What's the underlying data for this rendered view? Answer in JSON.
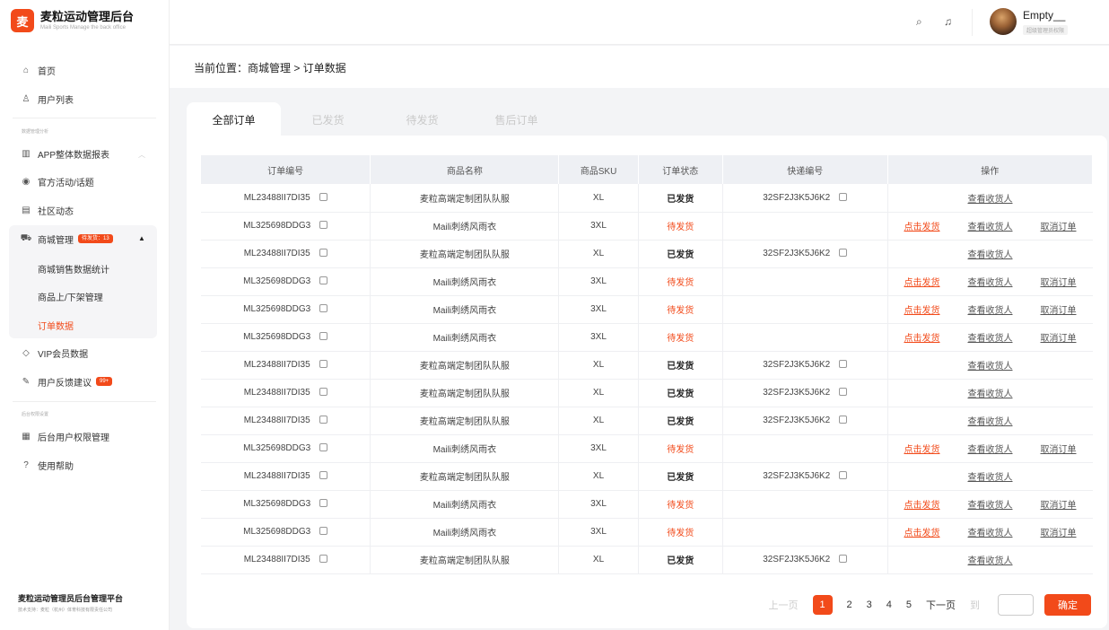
{
  "brand": {
    "title": "麦粒运动管理后台",
    "subtitle": "Maili Sports Manage the back office",
    "logo_text": "麦"
  },
  "sidebar": {
    "items_top": [
      {
        "label": "首页",
        "icon": "home-icon"
      },
      {
        "label": "用户列表",
        "icon": "user-icon"
      }
    ],
    "group1": "数据管理分析",
    "group1_items": [
      {
        "label": "APP整体数据报表",
        "icon": "bar-chart-icon"
      },
      {
        "label": "官方活动/话题",
        "icon": "activity-icon"
      },
      {
        "label": "社区动态",
        "icon": "community-icon"
      }
    ],
    "mall": {
      "label": "商城管理",
      "badge": "待发货：13",
      "icon": "cart-icon"
    },
    "mall_sub": [
      "商城销售数据统计",
      "商品上/下架管理",
      "订单数据"
    ],
    "items_after": [
      {
        "label": "VIP会员数据",
        "icon": "diamond-icon"
      },
      {
        "label": "用户反馈建议",
        "icon": "feedback-icon",
        "badge": "99+"
      }
    ],
    "group2": "后台权限设置",
    "group2_items": [
      {
        "label": "后台用户权限管理",
        "icon": "grid-icon"
      },
      {
        "label": "使用帮助",
        "icon": "help-icon"
      }
    ],
    "footer_title": "麦粒运动管理员后台管理平台",
    "footer_sub": "技术支持：麦粒（杭州）体育科技有限责任公司"
  },
  "header": {
    "user_name": "Empty__",
    "user_role": "超级管理员权限"
  },
  "breadcrumb": "当前位置：商城管理 > 订单数据",
  "tabs": [
    "全部订单",
    "已发货",
    "待发货",
    "售后订单"
  ],
  "table": {
    "headers": [
      "订单编号",
      "商品名称",
      "商品SKU",
      "订单状态",
      "快递编号",
      "操作"
    ],
    "actions": {
      "ship": "点击发货",
      "view": "查看收货人",
      "cancel": "取消订单"
    },
    "rows": [
      {
        "id": "ML23488II7DI35",
        "name": "麦粒高端定制团队队服",
        "sku": "XL",
        "status": "已发货",
        "tracking": "32SF2J3K5J6K2",
        "done": true
      },
      {
        "id": "ML325698DDG3",
        "name": "Maili刺绣风雨衣",
        "sku": "3XL",
        "status": "待发货",
        "tracking": "",
        "done": false
      },
      {
        "id": "ML23488II7DI35",
        "name": "麦粒高端定制团队队服",
        "sku": "XL",
        "status": "已发货",
        "tracking": "32SF2J3K5J6K2",
        "done": true
      },
      {
        "id": "ML325698DDG3",
        "name": "Maili刺绣风雨衣",
        "sku": "3XL",
        "status": "待发货",
        "tracking": "",
        "done": false
      },
      {
        "id": "ML325698DDG3",
        "name": "Maili刺绣风雨衣",
        "sku": "3XL",
        "status": "待发货",
        "tracking": "",
        "done": false
      },
      {
        "id": "ML325698DDG3",
        "name": "Maili刺绣风雨衣",
        "sku": "3XL",
        "status": "待发货",
        "tracking": "",
        "done": false
      },
      {
        "id": "ML23488II7DI35",
        "name": "麦粒高端定制团队队服",
        "sku": "XL",
        "status": "已发货",
        "tracking": "32SF2J3K5J6K2",
        "done": true
      },
      {
        "id": "ML23488II7DI35",
        "name": "麦粒高端定制团队队服",
        "sku": "XL",
        "status": "已发货",
        "tracking": "32SF2J3K5J6K2",
        "done": true
      },
      {
        "id": "ML23488II7DI35",
        "name": "麦粒高端定制团队队服",
        "sku": "XL",
        "status": "已发货",
        "tracking": "32SF2J3K5J6K2",
        "done": true
      },
      {
        "id": "ML325698DDG3",
        "name": "Maili刺绣风雨衣",
        "sku": "3XL",
        "status": "待发货",
        "tracking": "",
        "done": false
      },
      {
        "id": "ML23488II7DI35",
        "name": "麦粒高端定制团队队服",
        "sku": "XL",
        "status": "已发货",
        "tracking": "32SF2J3K5J6K2",
        "done": true
      },
      {
        "id": "ML325698DDG3",
        "name": "Maili刺绣风雨衣",
        "sku": "3XL",
        "status": "待发货",
        "tracking": "",
        "done": false
      },
      {
        "id": "ML325698DDG3",
        "name": "Maili刺绣风雨衣",
        "sku": "3XL",
        "status": "待发货",
        "tracking": "",
        "done": false
      },
      {
        "id": "ML23488II7DI35",
        "name": "麦粒高端定制团队队服",
        "sku": "XL",
        "status": "已发货",
        "tracking": "32SF2J3K5J6K2",
        "done": true
      }
    ]
  },
  "pagination": {
    "prev": "上一页",
    "pages": [
      "1",
      "2",
      "3",
      "4",
      "5"
    ],
    "current": "1",
    "next": "下一页",
    "jump_label": "到",
    "confirm": "确定"
  },
  "colors": {
    "accent": "#f24a1a"
  }
}
